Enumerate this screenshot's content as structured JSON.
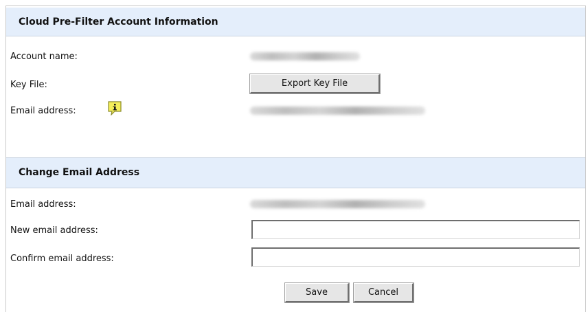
{
  "account_info": {
    "title": "Cloud Pre-Filter Account Information",
    "account_name_label": "Account name:",
    "key_file_label": "Key File:",
    "export_button_label": "Export Key File",
    "email_label": "Email address:",
    "info_icon": "info-speech-bubble-icon"
  },
  "change_email": {
    "title": "Change Email Address",
    "email_label": "Email address:",
    "new_email_label": "New email address:",
    "new_email_value": "",
    "confirm_email_label": "Confirm email address:",
    "confirm_email_value": "",
    "save_label": "Save",
    "cancel_label": "Cancel"
  },
  "colors": {
    "header_bg": "#e4eefb",
    "border": "#c8c8c8",
    "button_bg": "#e6e6e6",
    "icon_yellow": "#f4ee5a"
  }
}
